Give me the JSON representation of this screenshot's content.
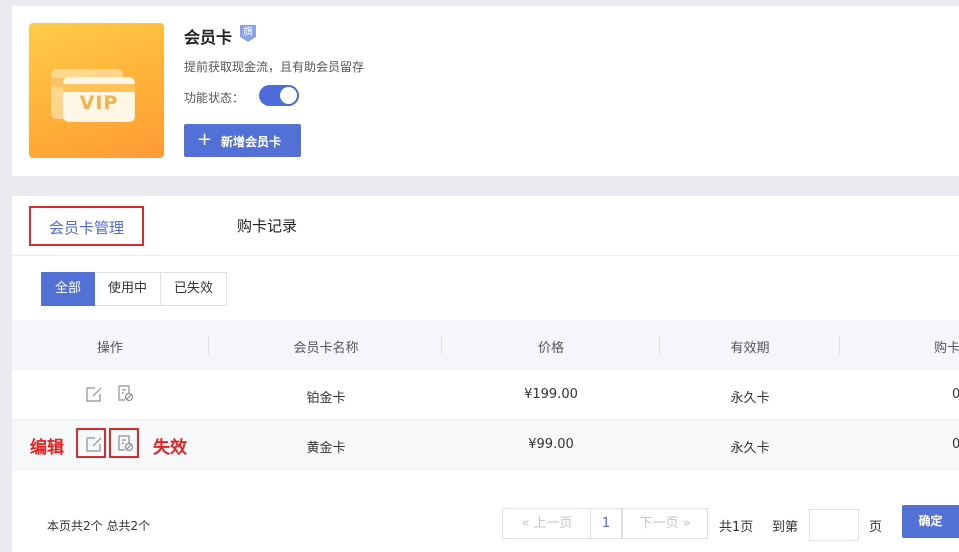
{
  "feature": {
    "title": "会员卡",
    "flag": "旗",
    "vip_text": "VIP",
    "description": "提前获取现金流，且有助会员留存",
    "status_label": "功能状态：",
    "status_on": true,
    "add_button": "新增会员卡"
  },
  "tabs": [
    {
      "label": "会员卡管理",
      "active": true
    },
    {
      "label": "购卡记录",
      "active": false
    }
  ],
  "filters": [
    {
      "label": "全部",
      "active": true
    },
    {
      "label": "使用中",
      "active": false
    },
    {
      "label": "已失效",
      "active": false
    }
  ],
  "table": {
    "headers": [
      "操作",
      "会员卡名称",
      "价格",
      "有效期",
      "购卡"
    ],
    "rows": [
      {
        "name": "铂金卡",
        "price": "¥199.00",
        "validity": "永久卡",
        "buy": "0"
      },
      {
        "name": "黄金卡",
        "price": "¥99.00",
        "validity": "永久卡",
        "buy": "0"
      }
    ]
  },
  "annotations": {
    "edit": "编辑",
    "disable": "失效"
  },
  "pagination": {
    "info": "本页共2个  总共2个",
    "prev": "上一页",
    "current": "1",
    "next": "下一页",
    "total": "共1页",
    "goto": "到第",
    "page_unit": "页",
    "confirm": "确定"
  },
  "colors": {
    "accent": "#5370d6",
    "annotation": "#e02222",
    "vip_tile": "#ffb338"
  }
}
